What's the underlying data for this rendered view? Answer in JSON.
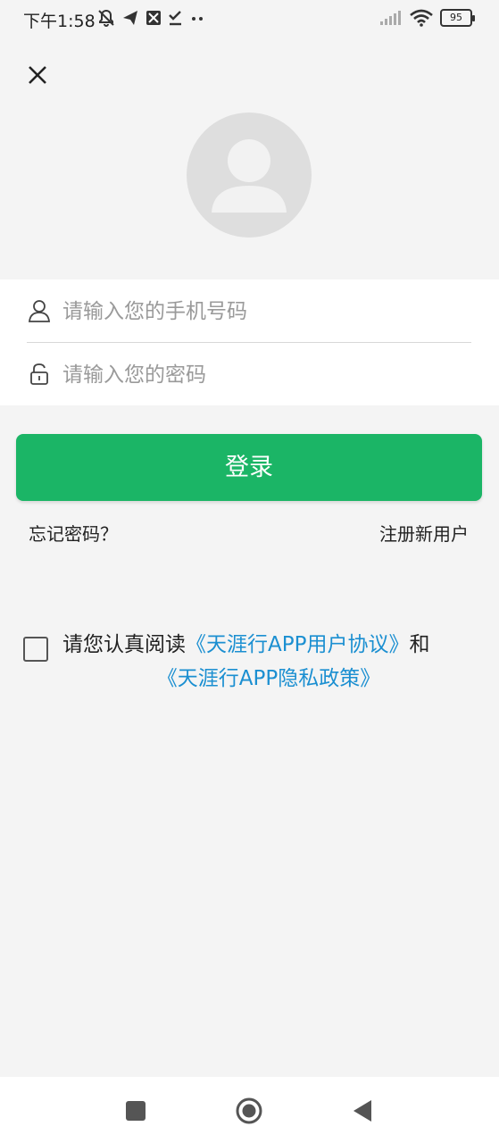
{
  "status_bar": {
    "time": "下午1:58",
    "battery": "95",
    "icons": [
      "mute-bell-icon",
      "send-icon",
      "photo-icon",
      "check-icon",
      "more-dots-icon",
      "signal-icon",
      "wifi-icon",
      "battery-icon"
    ]
  },
  "login": {
    "close_icon": "close-icon",
    "avatar_icon": "user-avatar-icon",
    "phone_placeholder": "请输入您的手机号码",
    "phone_value": "",
    "password_placeholder": "请输入您的密码",
    "password_value": "",
    "login_label": "登录",
    "forgot_label": "忘记密码？",
    "register_label": "注册新用户"
  },
  "agreement": {
    "checked": false,
    "prefix": "请您认真阅读",
    "user_agreement": "《天涯行APP用户协议》",
    "conjunction": "和",
    "privacy_policy": "《天涯行APP隐私政策》"
  },
  "colors": {
    "primary": "#1bb566",
    "link": "#1b8fd1",
    "background": "#f4f4f4"
  },
  "nav_bar": {
    "icons": [
      "recent-apps-icon",
      "home-icon",
      "back-icon"
    ]
  }
}
